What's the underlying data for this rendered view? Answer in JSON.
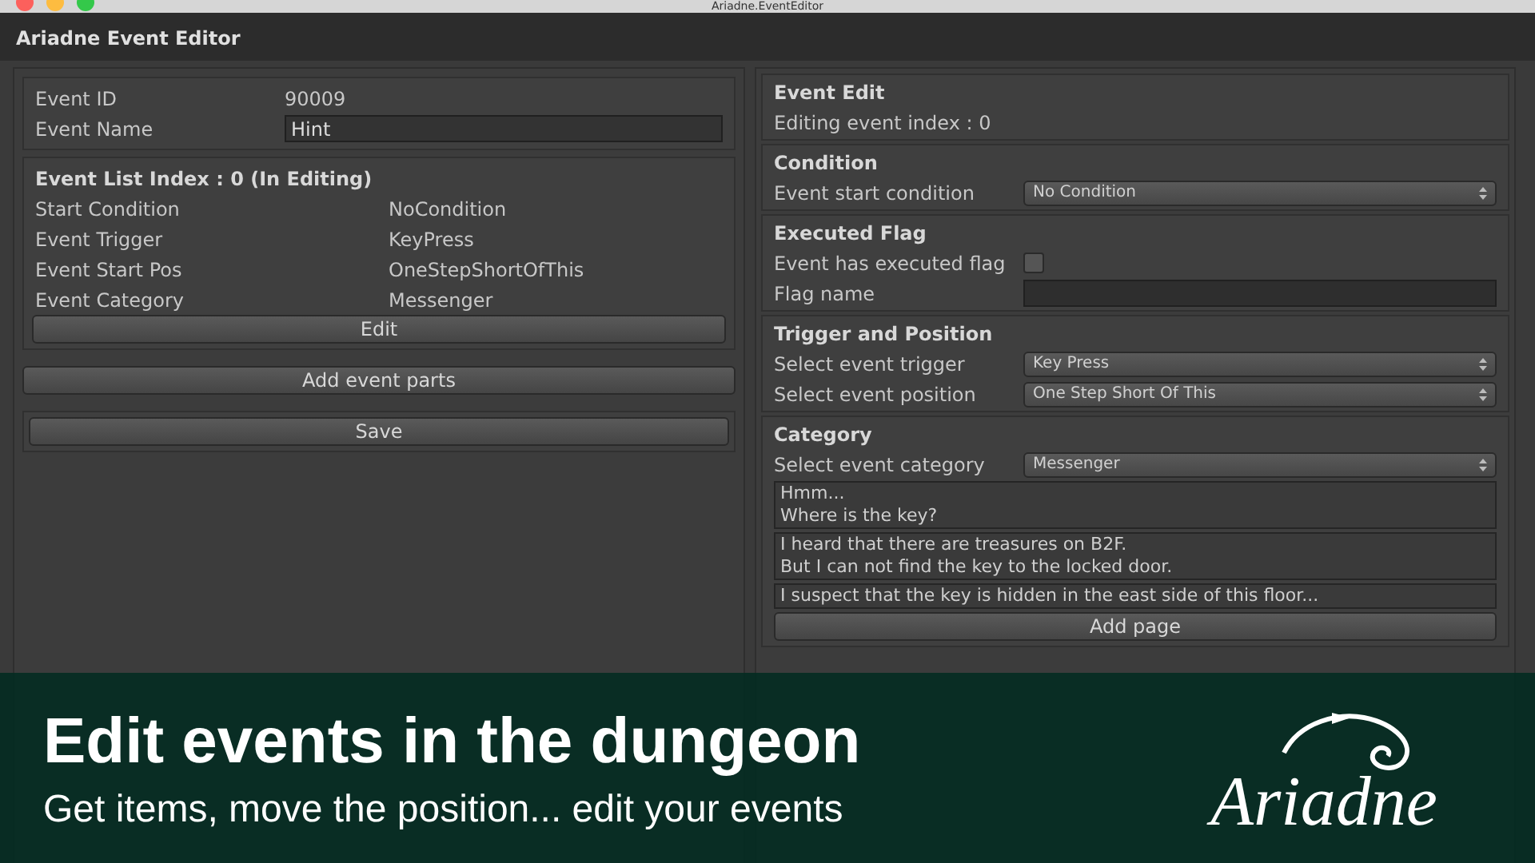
{
  "window": {
    "title": "Ariadne.EventEditor",
    "editor_title": "Ariadne Event Editor"
  },
  "event_info": {
    "fields": [
      {
        "label": "Event ID",
        "value": "90009",
        "kind": "text"
      },
      {
        "label": "Event Name",
        "value": "Hint",
        "kind": "input"
      }
    ]
  },
  "event_list": {
    "heading": "Event List Index : 0 (In Editing)",
    "rows": [
      {
        "label": "Start Condition",
        "value": "NoCondition"
      },
      {
        "label": "Event Trigger",
        "value": "KeyPress"
      },
      {
        "label": "Event Start Pos",
        "value": "OneStepShortOfThis"
      },
      {
        "label": "Event Category",
        "value": "Messenger"
      }
    ],
    "button": "Edit"
  },
  "add_parts_button": "Add event parts",
  "save_button": "Save",
  "event_edit": {
    "heading": "Event Edit",
    "subtitle": "Editing event index : 0"
  },
  "sections": [
    {
      "heading": "Condition",
      "rows": [
        {
          "label": "Event start condition",
          "kind": "dropdown",
          "value": "No Condition"
        }
      ]
    },
    {
      "heading": "Executed Flag",
      "rows": [
        {
          "label": "Event has executed flag",
          "kind": "checkbox",
          "checked": false
        },
        {
          "label": "Flag name",
          "kind": "input",
          "value": ""
        }
      ]
    },
    {
      "heading": "Trigger and Position",
      "rows": [
        {
          "label": "Select event trigger",
          "kind": "dropdown",
          "value": "Key Press"
        },
        {
          "label": "Select event position",
          "kind": "dropdown",
          "value": "One Step Short Of This"
        }
      ]
    },
    {
      "heading": "Category",
      "rows": [
        {
          "label": "Select event category",
          "kind": "dropdown",
          "value": "Messenger"
        }
      ]
    }
  ],
  "pages": [
    {
      "lines": [
        "Hmm...",
        "Where is the key?"
      ]
    },
    {
      "lines": [
        "I heard that there are treasures on B2F.",
        "But I can not find the key to the locked door."
      ]
    },
    {
      "lines": [
        "I suspect that the key is hidden in the east side of this floor..."
      ]
    }
  ],
  "page_buttons": [
    "Add page"
  ],
  "banner": {
    "headline": "Edit events in the dungeon",
    "tagline": "Get items, move the position... edit your events",
    "logo": "Ariadne"
  }
}
